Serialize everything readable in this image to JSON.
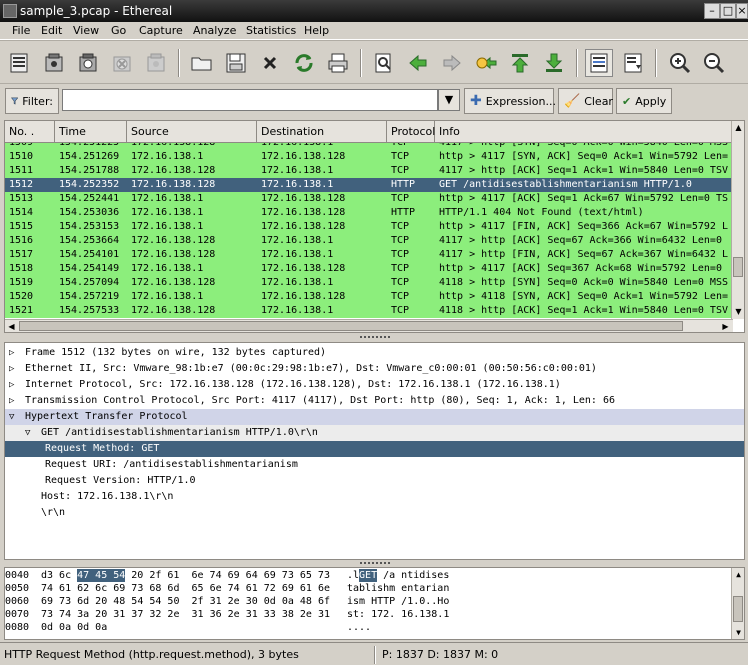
{
  "window": {
    "title": "sample_3.pcap - Ethereal"
  },
  "menubar": {
    "items": [
      {
        "label": "File"
      },
      {
        "label": "Edit"
      },
      {
        "label": "View"
      },
      {
        "label": "Go"
      },
      {
        "label": "Capture"
      },
      {
        "label": "Analyze"
      },
      {
        "label": "Statistics"
      },
      {
        "label": "Help"
      }
    ]
  },
  "filter": {
    "label": "Filter:",
    "value": "",
    "expression_label": "Expression...",
    "clear_label": "Clear",
    "apply_label": "Apply"
  },
  "packet_list": {
    "columns": [
      "No. .",
      "Time",
      "Source",
      "Destination",
      "Protocol",
      "Info"
    ],
    "rows": [
      {
        "no": "1509",
        "time": "154.251225",
        "src": "172.16.138.128",
        "dst": "172.16.138.1",
        "proto": "TCP",
        "info": "4117 > http [SYN] Seq=0 Ack=0 Win=5840 Len=0 MSS",
        "selected": false
      },
      {
        "no": "1510",
        "time": "154.251269",
        "src": "172.16.138.1",
        "dst": "172.16.138.128",
        "proto": "TCP",
        "info": "http > 4117 [SYN, ACK] Seq=0 Ack=1 Win=5792 Len=",
        "selected": false
      },
      {
        "no": "1511",
        "time": "154.251788",
        "src": "172.16.138.128",
        "dst": "172.16.138.1",
        "proto": "TCP",
        "info": "4117 > http [ACK] Seq=1 Ack=1 Win=5840 Len=0 TSV",
        "selected": false
      },
      {
        "no": "1512",
        "time": "154.252352",
        "src": "172.16.138.128",
        "dst": "172.16.138.1",
        "proto": "HTTP",
        "info": "GET /antidisestablishmentarianism HTTP/1.0",
        "selected": true
      },
      {
        "no": "1513",
        "time": "154.252441",
        "src": "172.16.138.1",
        "dst": "172.16.138.128",
        "proto": "TCP",
        "info": "http > 4117 [ACK] Seq=1 Ack=67 Win=5792 Len=0 TS",
        "selected": false
      },
      {
        "no": "1514",
        "time": "154.253036",
        "src": "172.16.138.1",
        "dst": "172.16.138.128",
        "proto": "HTTP",
        "info": "HTTP/1.1 404 Not Found (text/html)",
        "selected": false
      },
      {
        "no": "1515",
        "time": "154.253153",
        "src": "172.16.138.1",
        "dst": "172.16.138.128",
        "proto": "TCP",
        "info": "http > 4117 [FIN, ACK] Seq=366 Ack=67 Win=5792 L",
        "selected": false
      },
      {
        "no": "1516",
        "time": "154.253664",
        "src": "172.16.138.128",
        "dst": "172.16.138.1",
        "proto": "TCP",
        "info": "4117 > http [ACK] Seq=67 Ack=366 Win=6432 Len=0",
        "selected": false
      },
      {
        "no": "1517",
        "time": "154.254101",
        "src": "172.16.138.128",
        "dst": "172.16.138.1",
        "proto": "TCP",
        "info": "4117 > http [FIN, ACK] Seq=67 Ack=367 Win=6432 L",
        "selected": false
      },
      {
        "no": "1518",
        "time": "154.254149",
        "src": "172.16.138.1",
        "dst": "172.16.138.128",
        "proto": "TCP",
        "info": "http > 4117 [ACK] Seq=367 Ack=68 Win=5792 Len=0",
        "selected": false
      },
      {
        "no": "1519",
        "time": "154.257094",
        "src": "172.16.138.128",
        "dst": "172.16.138.1",
        "proto": "TCP",
        "info": "4118 > http [SYN] Seq=0 Ack=0 Win=5840 Len=0 MSS",
        "selected": false
      },
      {
        "no": "1520",
        "time": "154.257219",
        "src": "172.16.138.1",
        "dst": "172.16.138.128",
        "proto": "TCP",
        "info": "http > 4118 [SYN, ACK] Seq=0 Ack=1 Win=5792 Len=",
        "selected": false
      },
      {
        "no": "1521",
        "time": "154.257533",
        "src": "172.16.138.128",
        "dst": "172.16.138.1",
        "proto": "TCP",
        "info": "4118 > http [ACK] Seq=1 Ack=1 Win=5840 Len=0 TSV",
        "selected": false
      }
    ]
  },
  "details": {
    "rows": [
      {
        "text": "Frame 1512 (132 bytes on wire, 132 bytes captured)",
        "twisty": "▷",
        "indent": 0,
        "style": "normal"
      },
      {
        "text": "Ethernet II, Src: Vmware_98:1b:e7 (00:0c:29:98:1b:e7), Dst: Vmware_c0:00:01 (00:50:56:c0:00:01)",
        "twisty": "▷",
        "indent": 0,
        "style": "normal"
      },
      {
        "text": "Internet Protocol, Src: 172.16.138.128 (172.16.138.128), Dst: 172.16.138.1 (172.16.138.1)",
        "twisty": "▷",
        "indent": 0,
        "style": "normal"
      },
      {
        "text": "Transmission Control Protocol, Src Port: 4117 (4117), Dst Port: http (80), Seq: 1, Ack: 1, Len: 66",
        "twisty": "▷",
        "indent": 0,
        "style": "normal"
      },
      {
        "text": "Hypertext Transfer Protocol",
        "twisty": "▽",
        "indent": 0,
        "style": "hl"
      },
      {
        "text": "GET /antidisestablishmentarianism HTTP/1.0\\r\\n",
        "twisty": "▽",
        "indent": 1,
        "style": "shaded"
      },
      {
        "text": "Request Method: GET",
        "twisty": "",
        "indent": 2,
        "style": "sel"
      },
      {
        "text": "Request URI: /antidisestablishmentarianism",
        "twisty": "",
        "indent": 2,
        "style": "normal"
      },
      {
        "text": "Request Version: HTTP/1.0",
        "twisty": "",
        "indent": 2,
        "style": "normal"
      },
      {
        "text": "Host: 172.16.138.1\\r\\n",
        "twisty": "",
        "indent": 1,
        "style": "normal"
      },
      {
        "text": "\\r\\n",
        "twisty": "",
        "indent": 1,
        "style": "normal"
      }
    ]
  },
  "hex": {
    "rows": [
      {
        "offset": "0040",
        "pre": "d3 6c ",
        "hl": "47 45 54",
        "post": " 20 2f 61  6e 74 69 64 69 73 65 73",
        "ascii_pre": ".l",
        "ascii_hl": "GET",
        "ascii_post": " /a ntidises"
      },
      {
        "offset": "0050",
        "pre": "74 61 62 6c 69 73 68 6d  65 6e 74 61 72 69 61 6e",
        "hl": "",
        "post": "",
        "ascii_pre": "tablishm entarian",
        "ascii_hl": "",
        "ascii_post": ""
      },
      {
        "offset": "0060",
        "pre": "69 73 6d 20 48 54 54 50  2f 31 2e 30 0d 0a 48 6f",
        "hl": "",
        "post": "",
        "ascii_pre": "ism HTTP /1.0..Ho",
        "ascii_hl": "",
        "ascii_post": ""
      },
      {
        "offset": "0070",
        "pre": "73 74 3a 20 31 37 32 2e  31 36 2e 31 33 38 2e 31",
        "hl": "",
        "post": "",
        "ascii_pre": "st: 172. 16.138.1",
        "ascii_hl": "",
        "ascii_post": ""
      },
      {
        "offset": "0080",
        "pre": "0d 0a 0d 0a",
        "hl": "",
        "post": "",
        "ascii_pre": "....",
        "ascii_hl": "",
        "ascii_post": ""
      }
    ]
  },
  "statusbar": {
    "left": "HTTP Request Method (http.request.method), 3 bytes",
    "right": "P: 1837 D: 1837 M: 0"
  },
  "colors": {
    "row_green": "#8cee7c",
    "selection": "#41617d"
  }
}
